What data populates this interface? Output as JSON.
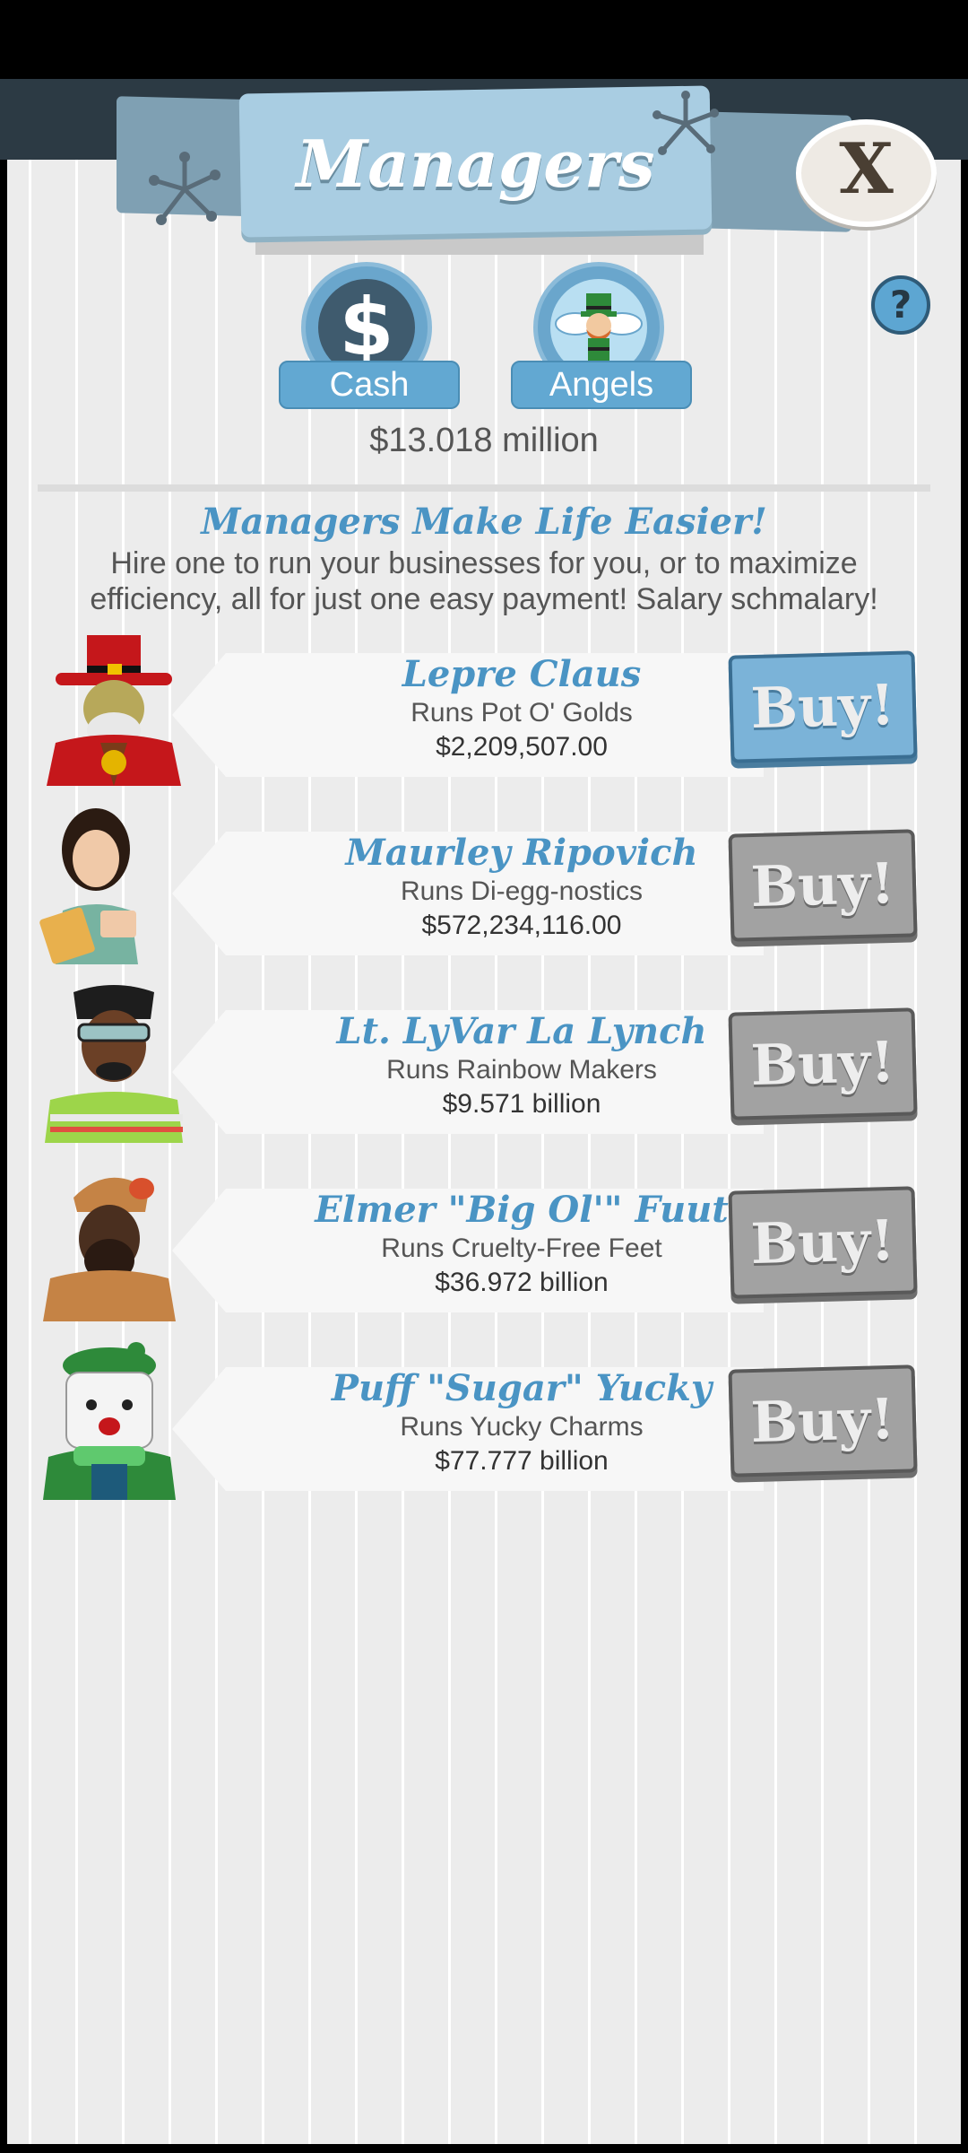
{
  "header": {
    "title": "Managers",
    "close_label": "X",
    "help_label": "?"
  },
  "tabs": [
    {
      "label": "Cash",
      "icon": "dollar-icon",
      "glyph": "$"
    },
    {
      "label": "Angels",
      "icon": "angel-leprechaun-icon"
    }
  ],
  "cash_amount": "$13.018 million",
  "intro": {
    "title": "Managers Make Life Easier!",
    "body": "Hire one to run your businesses for you, or to maximize efficiency, all for just one easy payment! Salary schmalary!"
  },
  "managers": [
    {
      "name": "Lepre Claus",
      "runs": "Runs Pot O' Golds",
      "cost": "$2,209,507.00",
      "buy_label": "Buy!",
      "affordable": true
    },
    {
      "name": "Maurley Ripovich",
      "runs": "Runs Di-egg-nostics",
      "cost": "$572,234,116.00",
      "buy_label": "Buy!",
      "affordable": false
    },
    {
      "name": "Lt. LyVar La Lynch",
      "runs": "Runs Rainbow Makers",
      "cost": "$9.571 billion",
      "buy_label": "Buy!",
      "affordable": false
    },
    {
      "name": "Elmer \"Big Ol'\" Fuut",
      "runs": "Runs Cruelty-Free Feet",
      "cost": "$36.972 billion",
      "buy_label": "Buy!",
      "affordable": false
    },
    {
      "name": "Puff \"Sugar\" Yucky",
      "runs": "Runs Yucky Charms",
      "cost": "$77.777 billion",
      "buy_label": "Buy!",
      "affordable": false
    }
  ],
  "colors": {
    "accent": "#4a94c4",
    "buy_active": "#7bb3d8",
    "buy_inactive": "#a2a2a2"
  }
}
